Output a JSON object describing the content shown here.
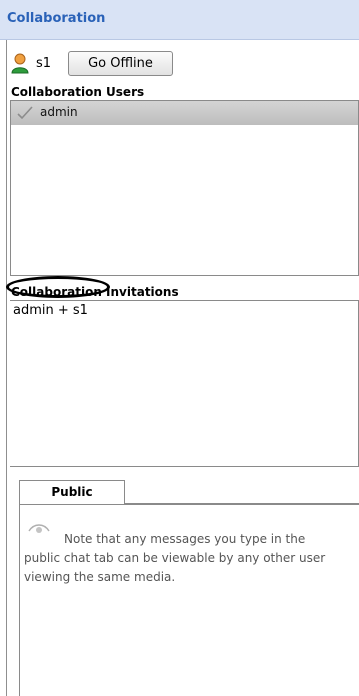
{
  "header": {
    "title": "Collaboration"
  },
  "status": {
    "user_name": "s1",
    "offline_button_label": "Go Offline",
    "user_icon": "user-icon"
  },
  "users_section": {
    "label": "Collaboration Users",
    "items": [
      {
        "label": "admin",
        "icon": "check-icon"
      }
    ]
  },
  "invitations_section": {
    "label": "Collaboration Invitations",
    "items": [
      {
        "label": "admin + s1"
      }
    ]
  },
  "chat": {
    "tabs": [
      {
        "label": "Public"
      }
    ],
    "note": "Note that any messages you type in the public chat tab can be viewable by any other user viewing the same media.",
    "note_icon": "eye-icon"
  },
  "colors": {
    "header_bg": "#d9e3f5",
    "header_text": "#2a62b8",
    "selected_row": "#c6c6c6"
  }
}
